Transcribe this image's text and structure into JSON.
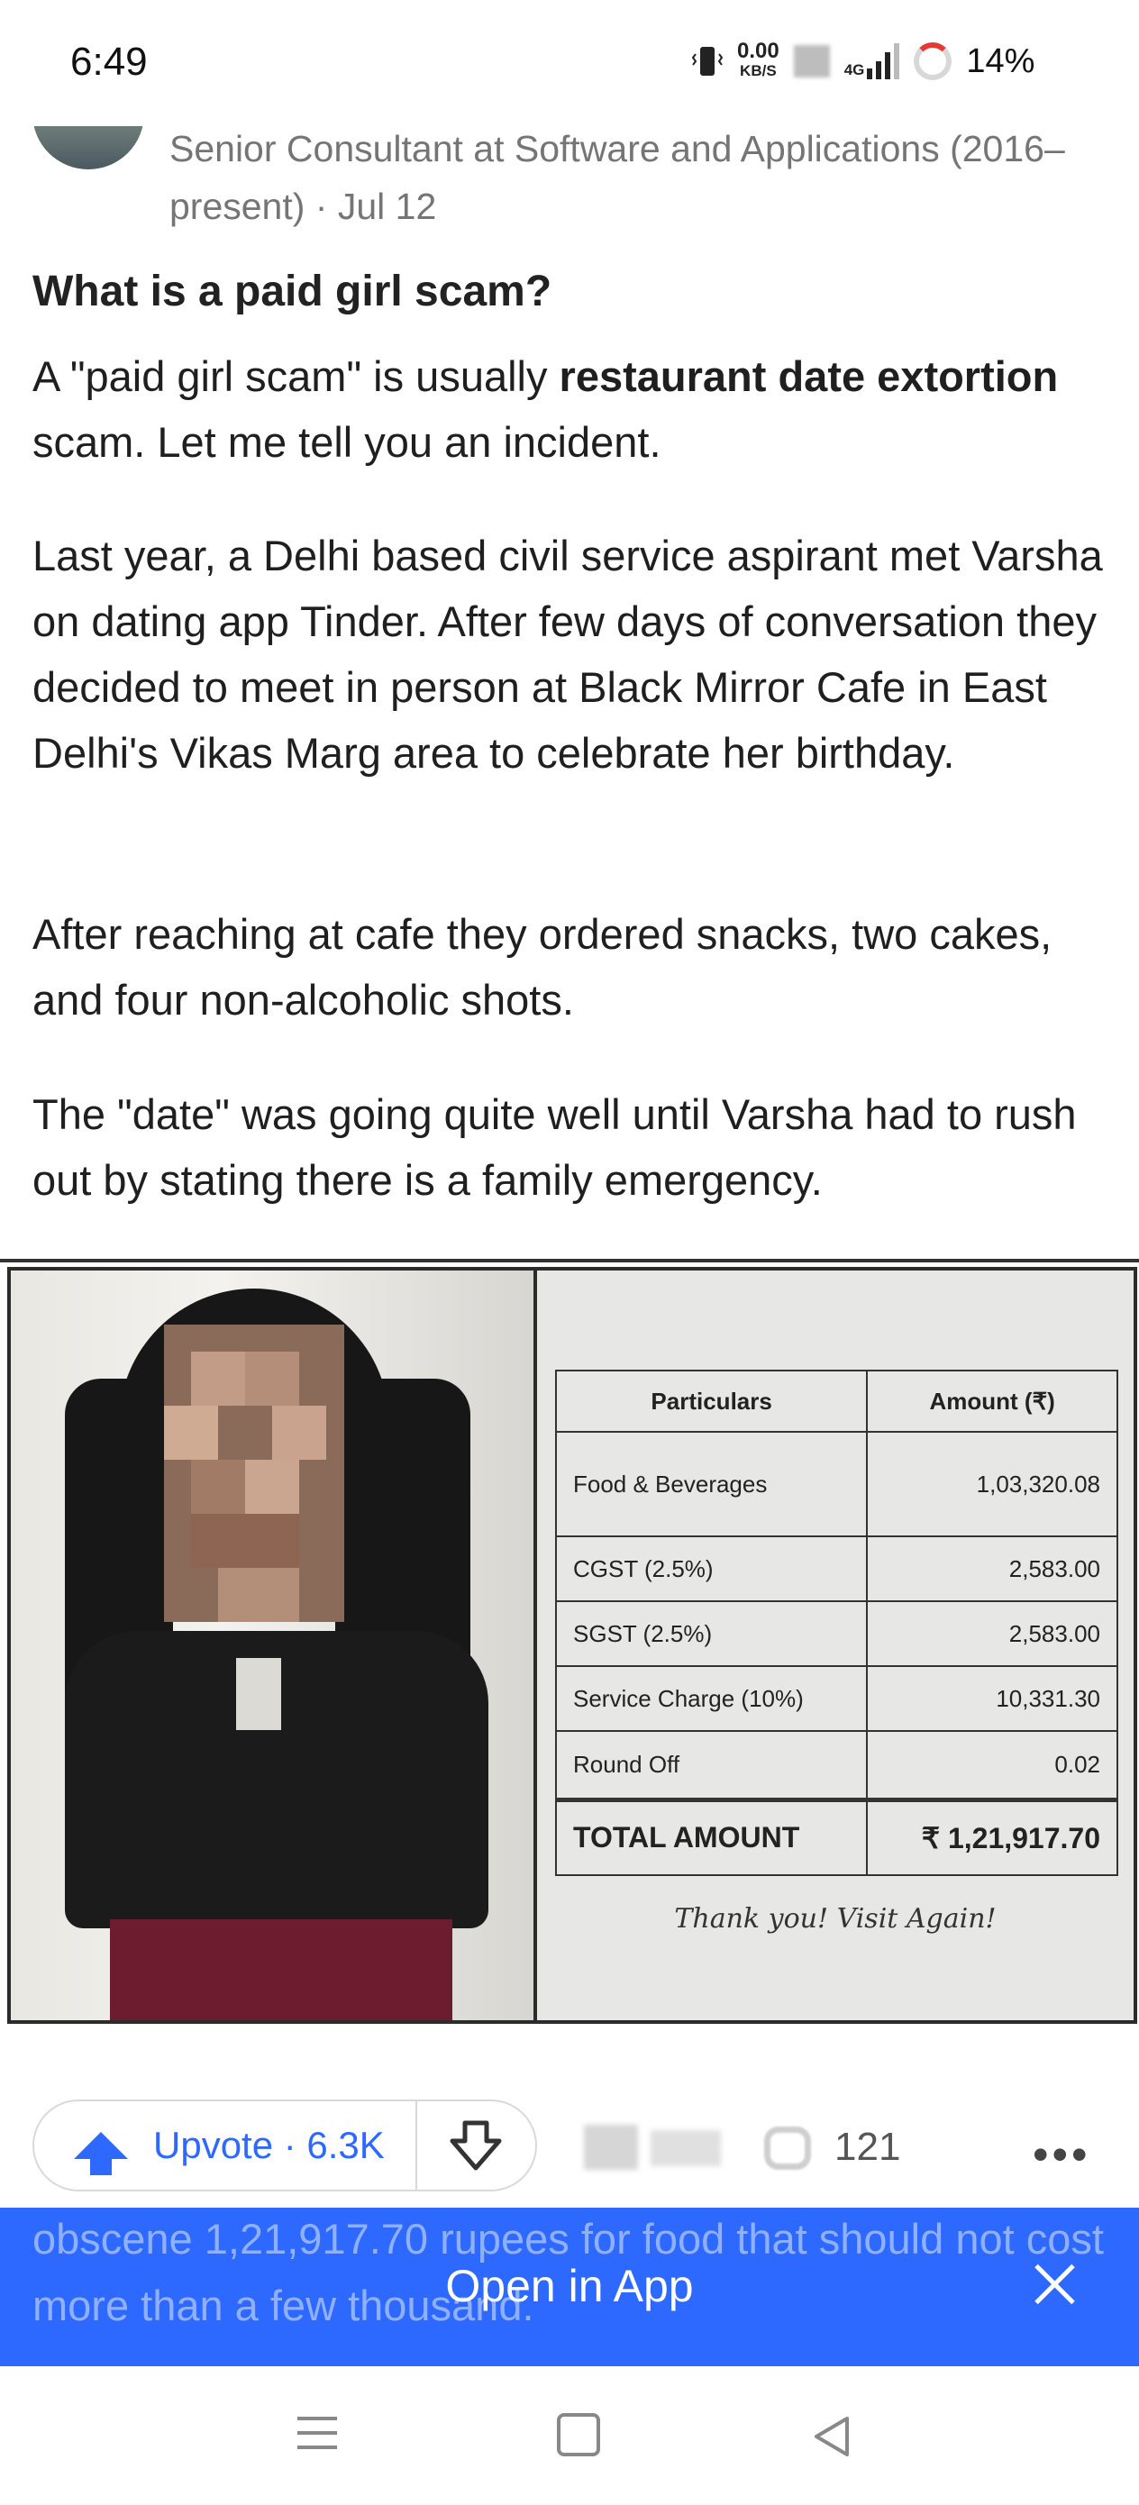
{
  "status_bar": {
    "time": "6:49",
    "net_speed": "0.00",
    "net_unit": "KB/S",
    "network": "4G",
    "battery": "14%"
  },
  "post": {
    "author_credential": "Senior Consultant at Software and Applications (2016–present) · Jul 12",
    "title": "What is a paid girl scam?",
    "p1_a": "A \"paid girl scam\" is usually ",
    "p1_b": "restaurant date extortion",
    "p1_c": " scam. Let me tell you an incident.",
    "p2": "Last year, a Delhi based civil service aspirant met Varsha on dating app Tinder. After few days of conversation they decided to meet in person at Black Mirror Cafe in East Delhi's Vikas Marg area to celebrate her birthday.",
    "p3": "After reaching at cafe they ordered snacks, two cakes, and four non-alcoholic shots.",
    "p4": "The \"date\" was going quite well until Varsha had to rush out by stating there is a family emergency.",
    "next_partial": "obscene 1,21,917.70 rupees for food that should not cost more than a few thousand."
  },
  "receipt": {
    "header_particulars": "Particulars",
    "header_amount": "Amount (₹)",
    "rows": [
      {
        "label": "Food & Beverages",
        "amount": "1,03,320.08"
      },
      {
        "label": "CGST (2.5%)",
        "amount": "2,583.00"
      },
      {
        "label": "SGST (2.5%)",
        "amount": "2,583.00"
      },
      {
        "label": "Service Charge (10%)",
        "amount": "10,331.30"
      },
      {
        "label": "Round Off",
        "amount": "0.02"
      }
    ],
    "total_label": "TOTAL AMOUNT",
    "total_amount": "₹ 1,21,917.70",
    "thanks": "Thank you! Visit Again!"
  },
  "actions": {
    "upvote_label": "Upvote · 6.3K",
    "comment_count": "121",
    "more": "•••"
  },
  "banner": {
    "label": "Open in App"
  }
}
